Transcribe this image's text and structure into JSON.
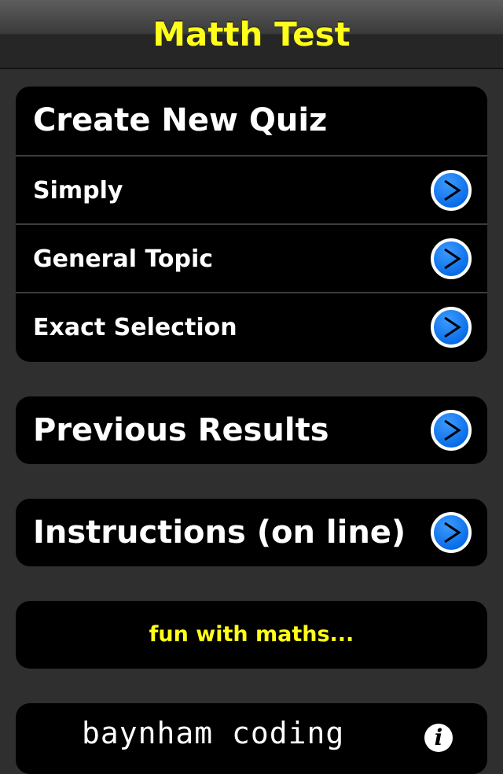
{
  "nav": {
    "title": "Matth Test"
  },
  "create_quiz": {
    "header": "Create New Quiz",
    "items": [
      {
        "label": "Simply"
      },
      {
        "label": "General Topic"
      },
      {
        "label": "Exact Selection"
      }
    ]
  },
  "previous_results": {
    "label": "Previous Results"
  },
  "instructions": {
    "label": "Instructions (on line)"
  },
  "tagline": {
    "text": "fun with maths..."
  },
  "footer": {
    "brand": "baynham coding",
    "info_glyph": "i"
  },
  "icons": {
    "disclosure": "chevron-right-icon",
    "info": "info-icon"
  },
  "colors": {
    "title_yellow": "#ffff1a",
    "background": "#2f2f2f",
    "group_black": "#000000",
    "accent_blue": "#0a6ee8"
  }
}
